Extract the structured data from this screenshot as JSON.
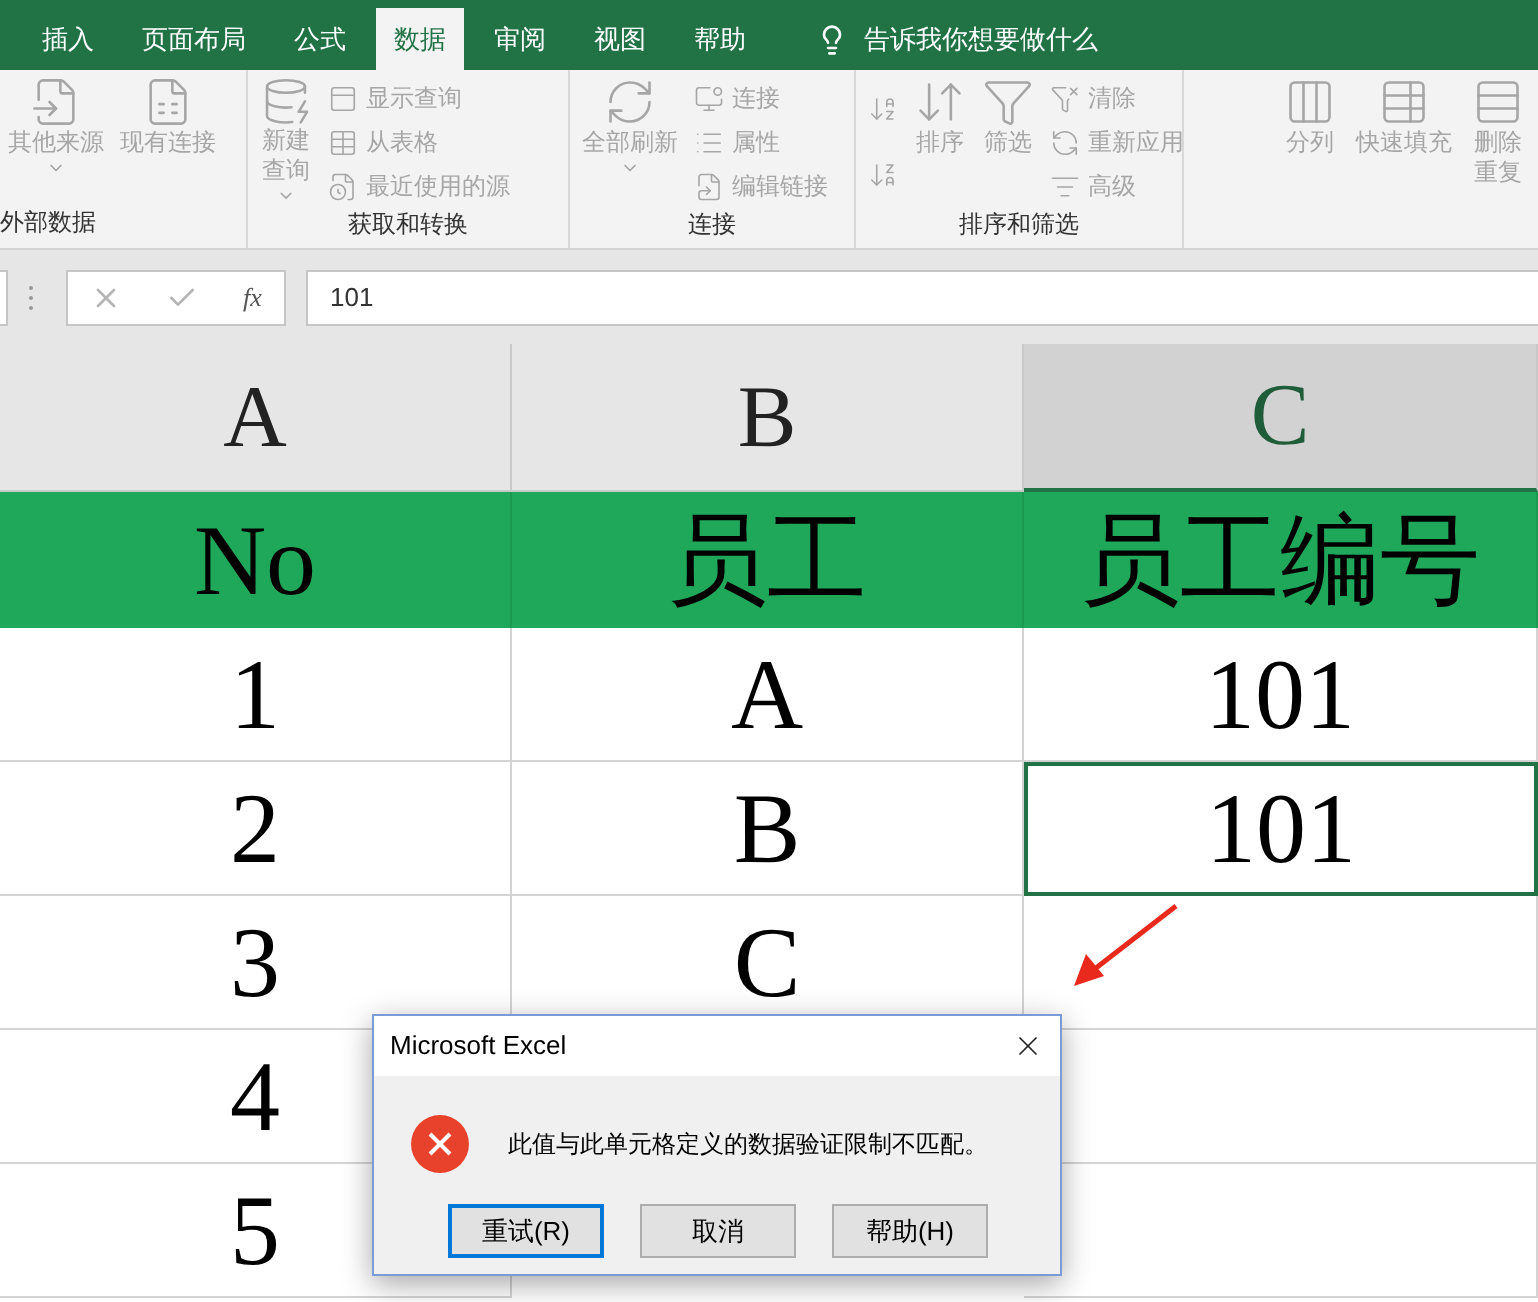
{
  "tabs": [
    {
      "label": "插入",
      "selected": false
    },
    {
      "label": "页面布局",
      "selected": false
    },
    {
      "label": "公式",
      "selected": false
    },
    {
      "label": "数据",
      "selected": true
    },
    {
      "label": "审阅",
      "selected": false
    },
    {
      "label": "视图",
      "selected": false
    },
    {
      "label": "帮助",
      "selected": false
    }
  ],
  "tell_me": "告诉我你想要做什么",
  "ribbon_groups": [
    {
      "label": "外部数据",
      "columns": [
        {
          "kind": "large",
          "lines": [
            "其他来源"
          ],
          "dropdown": true,
          "disabled": true
        },
        {
          "kind": "large",
          "lines": [
            "现有连接"
          ],
          "dropdown": false,
          "disabled": true
        }
      ]
    },
    {
      "label": "获取和转换",
      "columns": [
        {
          "kind": "large",
          "lines": [
            "新建",
            "查询"
          ],
          "dropdown": true,
          "disabled": true
        },
        {
          "kind": "stack",
          "items": [
            {
              "label": "显示查询",
              "disabled": true
            },
            {
              "label": "从表格",
              "disabled": true
            },
            {
              "label": "最近使用的源",
              "disabled": true
            }
          ]
        }
      ]
    },
    {
      "label": "连接",
      "columns": [
        {
          "kind": "large",
          "lines": [
            "全部刷新"
          ],
          "dropdown": true,
          "disabled": true
        },
        {
          "kind": "stack",
          "items": [
            {
              "label": "连接",
              "disabled": true
            },
            {
              "label": "属性",
              "disabled": true
            },
            {
              "label": "编辑链接",
              "disabled": true
            }
          ]
        }
      ]
    },
    {
      "label": "排序和筛选",
      "columns": [
        {
          "kind": "stack",
          "items": [
            {
              "disabled": true
            },
            {
              "disabled": true
            }
          ]
        },
        {
          "kind": "large",
          "lines": [
            "排序"
          ],
          "dropdown": false,
          "disabled": true
        },
        {
          "kind": "large",
          "lines": [
            "筛选"
          ],
          "dropdown": false,
          "disabled": true
        },
        {
          "kind": "stack",
          "items": [
            {
              "label": "清除",
              "disabled": true
            },
            {
              "label": "重新应用",
              "disabled": true
            },
            {
              "label": "高级",
              "disabled": true
            }
          ]
        }
      ]
    },
    {
      "columns": [
        {
          "kind": "large",
          "lines": [
            "分列"
          ],
          "dropdown": false,
          "disabled": true
        },
        {
          "kind": "large",
          "lines": [
            "快速填充"
          ],
          "dropdown": false,
          "disabled": true
        },
        {
          "kind": "large",
          "lines": [
            "删除",
            "重复"
          ],
          "dropdown": false,
          "disabled": true
        }
      ]
    }
  ],
  "formula_bar": {
    "fx": "fx",
    "value": "101"
  },
  "columns": [
    {
      "label": "A",
      "selected": false
    },
    {
      "label": "B",
      "selected": false
    },
    {
      "label": "C",
      "selected": true
    }
  ],
  "title_row": [
    "No",
    "员工",
    "员工编号"
  ],
  "rows": [
    {
      "cells": [
        {
          "text": "1",
          "selected": false
        },
        {
          "text": "A",
          "selected": false
        },
        {
          "text": "101",
          "selected": false
        }
      ]
    },
    {
      "cells": [
        {
          "text": "2",
          "selected": false
        },
        {
          "text": "B",
          "selected": false
        },
        {
          "text": "101",
          "selected": true
        }
      ]
    },
    {
      "cells": [
        {
          "text": "3",
          "selected": false
        },
        {
          "text": "C",
          "selected": false
        },
        {
          "selected": false
        }
      ]
    },
    {
      "cells": [
        {
          "text": "4",
          "selected": false
        },
        null,
        {
          "selected": false
        }
      ]
    },
    {
      "cells": [
        {
          "text": "5",
          "selected": false
        },
        null,
        {
          "selected": false
        }
      ]
    }
  ],
  "dialog": {
    "title": "Microsoft Excel",
    "message": "此值与此单元格定义的数据验证限制不匹配。",
    "buttons": [
      {
        "label": "重试(R)",
        "selected": true
      },
      {
        "label": "取消",
        "selected": false
      },
      {
        "label": "帮助(H)",
        "selected": false
      }
    ]
  }
}
